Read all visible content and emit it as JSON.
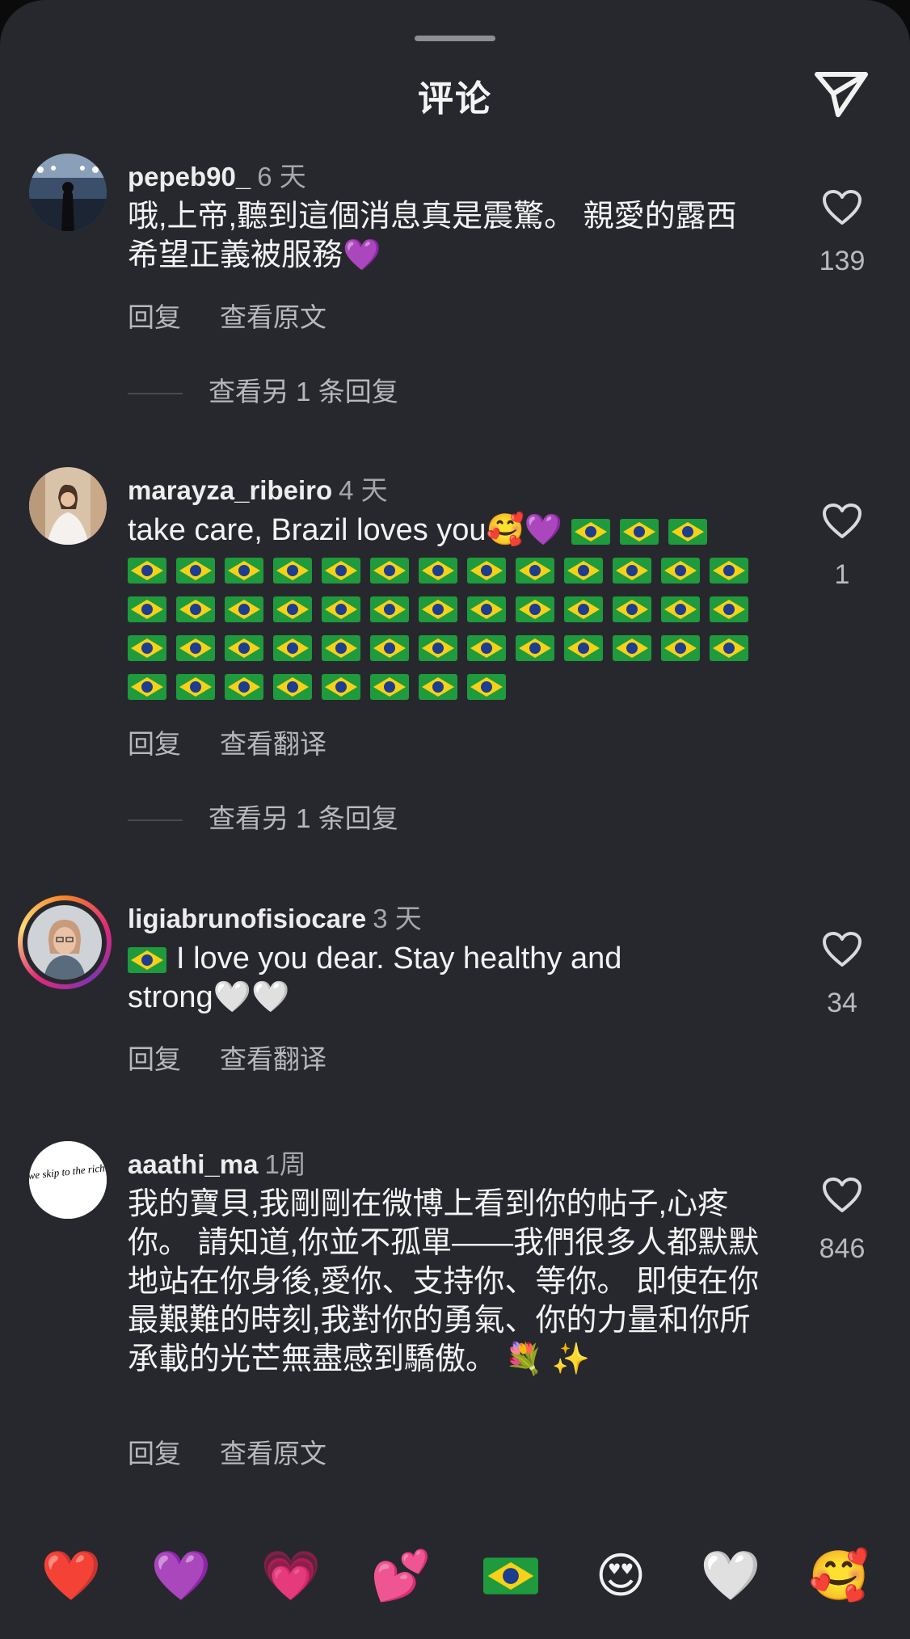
{
  "header": {
    "title": "评论"
  },
  "comments": [
    {
      "username": "pepeb90_",
      "time": "6 天",
      "text": "哦,上帝,聽到這個消息真是震驚。 親愛的露西希望正義被服務",
      "reply_label": "回复",
      "translate_label": "查看原文",
      "likes": "139",
      "more_replies": "查看另 1 条回复",
      "avatar_icon": "concert-stage-avatar"
    },
    {
      "username": "marayza_ribeiro",
      "time": "4 天",
      "text": "take care, Brazil loves you",
      "flag_count": 50,
      "reply_label": "回复",
      "translate_label": "查看翻译",
      "likes": "1",
      "more_replies": "查看另 1 条回复",
      "avatar_icon": "bride-avatar"
    },
    {
      "username": "ligiabrunofisiocare",
      "time": "3 天",
      "text_a": "I love you dear. Stay healthy and strong",
      "reply_label": "回复",
      "translate_label": "查看翻译",
      "likes": "34",
      "avatar_icon": "woman-portrait-avatar"
    },
    {
      "username": "aaathi_ma",
      "time": "1周",
      "text": "我的寶貝,我剛剛在微博上看到你的帖子,心疼你。 請知道,你並不孤單——我們很多人都默默地站在你身後,愛你、支持你、等你。 即使在你最艱難的時刻,我對你的勇氣、你的力量和你所承載的光芒無盡感到驕傲。",
      "reply_label": "回复",
      "translate_label": "查看原文",
      "likes": "846",
      "avatar_text": "can we skip to the rich part"
    }
  ],
  "emoji_bar": [
    "red-heart",
    "purple-heart",
    "growing-heart",
    "two-hearts",
    "brazil-flag",
    "heart-eyes-face",
    "white-heart",
    "smiling-face-with-hearts"
  ],
  "colors": {
    "background": "#27282d",
    "text": "#f3f3f4",
    "muted": "#b7b8bd",
    "brazil_green": "#1f9a3c",
    "brazil_yellow": "#f7d117",
    "brazil_blue": "#1d3d8f"
  }
}
